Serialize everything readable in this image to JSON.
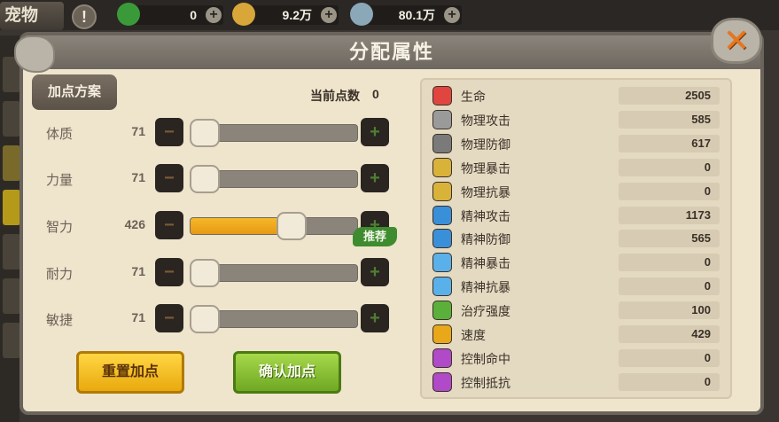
{
  "topbar": {
    "pet_tab": "宠物",
    "info": "!",
    "resources": [
      {
        "icon": "green-gem-icon",
        "value": "0",
        "color": "#3a9a3a"
      },
      {
        "icon": "gold-nugget-icon",
        "value": "9.2万",
        "color": "#d9a63a"
      },
      {
        "icon": "silver-ore-icon",
        "value": "80.1万",
        "color": "#8aa8b8"
      }
    ],
    "plus": "+"
  },
  "dialog": {
    "title": "分配属性",
    "close": "✕",
    "plan_label": "加点方案",
    "points_label": "当前点数",
    "points_value": "0",
    "recommend_badge": "推荐",
    "minus": "−",
    "plus": "+",
    "stats": [
      {
        "name": "体质",
        "value": "71",
        "fill": 0.0
      },
      {
        "name": "力量",
        "value": "71",
        "fill": 0.0
      },
      {
        "name": "智力",
        "value": "426",
        "fill": 0.62
      },
      {
        "name": "耐力",
        "value": "71",
        "fill": 0.0
      },
      {
        "name": "敏捷",
        "value": "71",
        "fill": 0.0
      }
    ],
    "reset_button": "重置加点",
    "confirm_button": "确认加点"
  },
  "attributes": [
    {
      "name": "生命",
      "value": "2505",
      "icon": "heart-icon",
      "color": "#e0463f"
    },
    {
      "name": "物理攻击",
      "value": "585",
      "icon": "fist-icon",
      "color": "#9a9a9a"
    },
    {
      "name": "物理防御",
      "value": "617",
      "icon": "shield-icon",
      "color": "#7a7a7a"
    },
    {
      "name": "物理暴击",
      "value": "0",
      "icon": "crit-fist-icon",
      "color": "#d9b23a"
    },
    {
      "name": "物理抗暴",
      "value": "0",
      "icon": "crit-shield-icon",
      "color": "#d9b23a"
    },
    {
      "name": "精神攻击",
      "value": "1173",
      "icon": "magic-attack-icon",
      "color": "#3a8fd9"
    },
    {
      "name": "精神防御",
      "value": "565",
      "icon": "magic-shield-icon",
      "color": "#3a8fd9"
    },
    {
      "name": "精神暴击",
      "value": "0",
      "icon": "magic-crit-icon",
      "color": "#5ab0e8"
    },
    {
      "name": "精神抗暴",
      "value": "0",
      "icon": "magic-crit-shield-icon",
      "color": "#5ab0e8"
    },
    {
      "name": "治疗强度",
      "value": "100",
      "icon": "heal-cross-icon",
      "color": "#5ab03a"
    },
    {
      "name": "速度",
      "value": "429",
      "icon": "lightning-icon",
      "color": "#e8a81a"
    },
    {
      "name": "控制命中",
      "value": "0",
      "icon": "control-hit-icon",
      "color": "#b04ac8"
    },
    {
      "name": "控制抵抗",
      "value": "0",
      "icon": "control-resist-icon",
      "color": "#b04ac8"
    }
  ]
}
